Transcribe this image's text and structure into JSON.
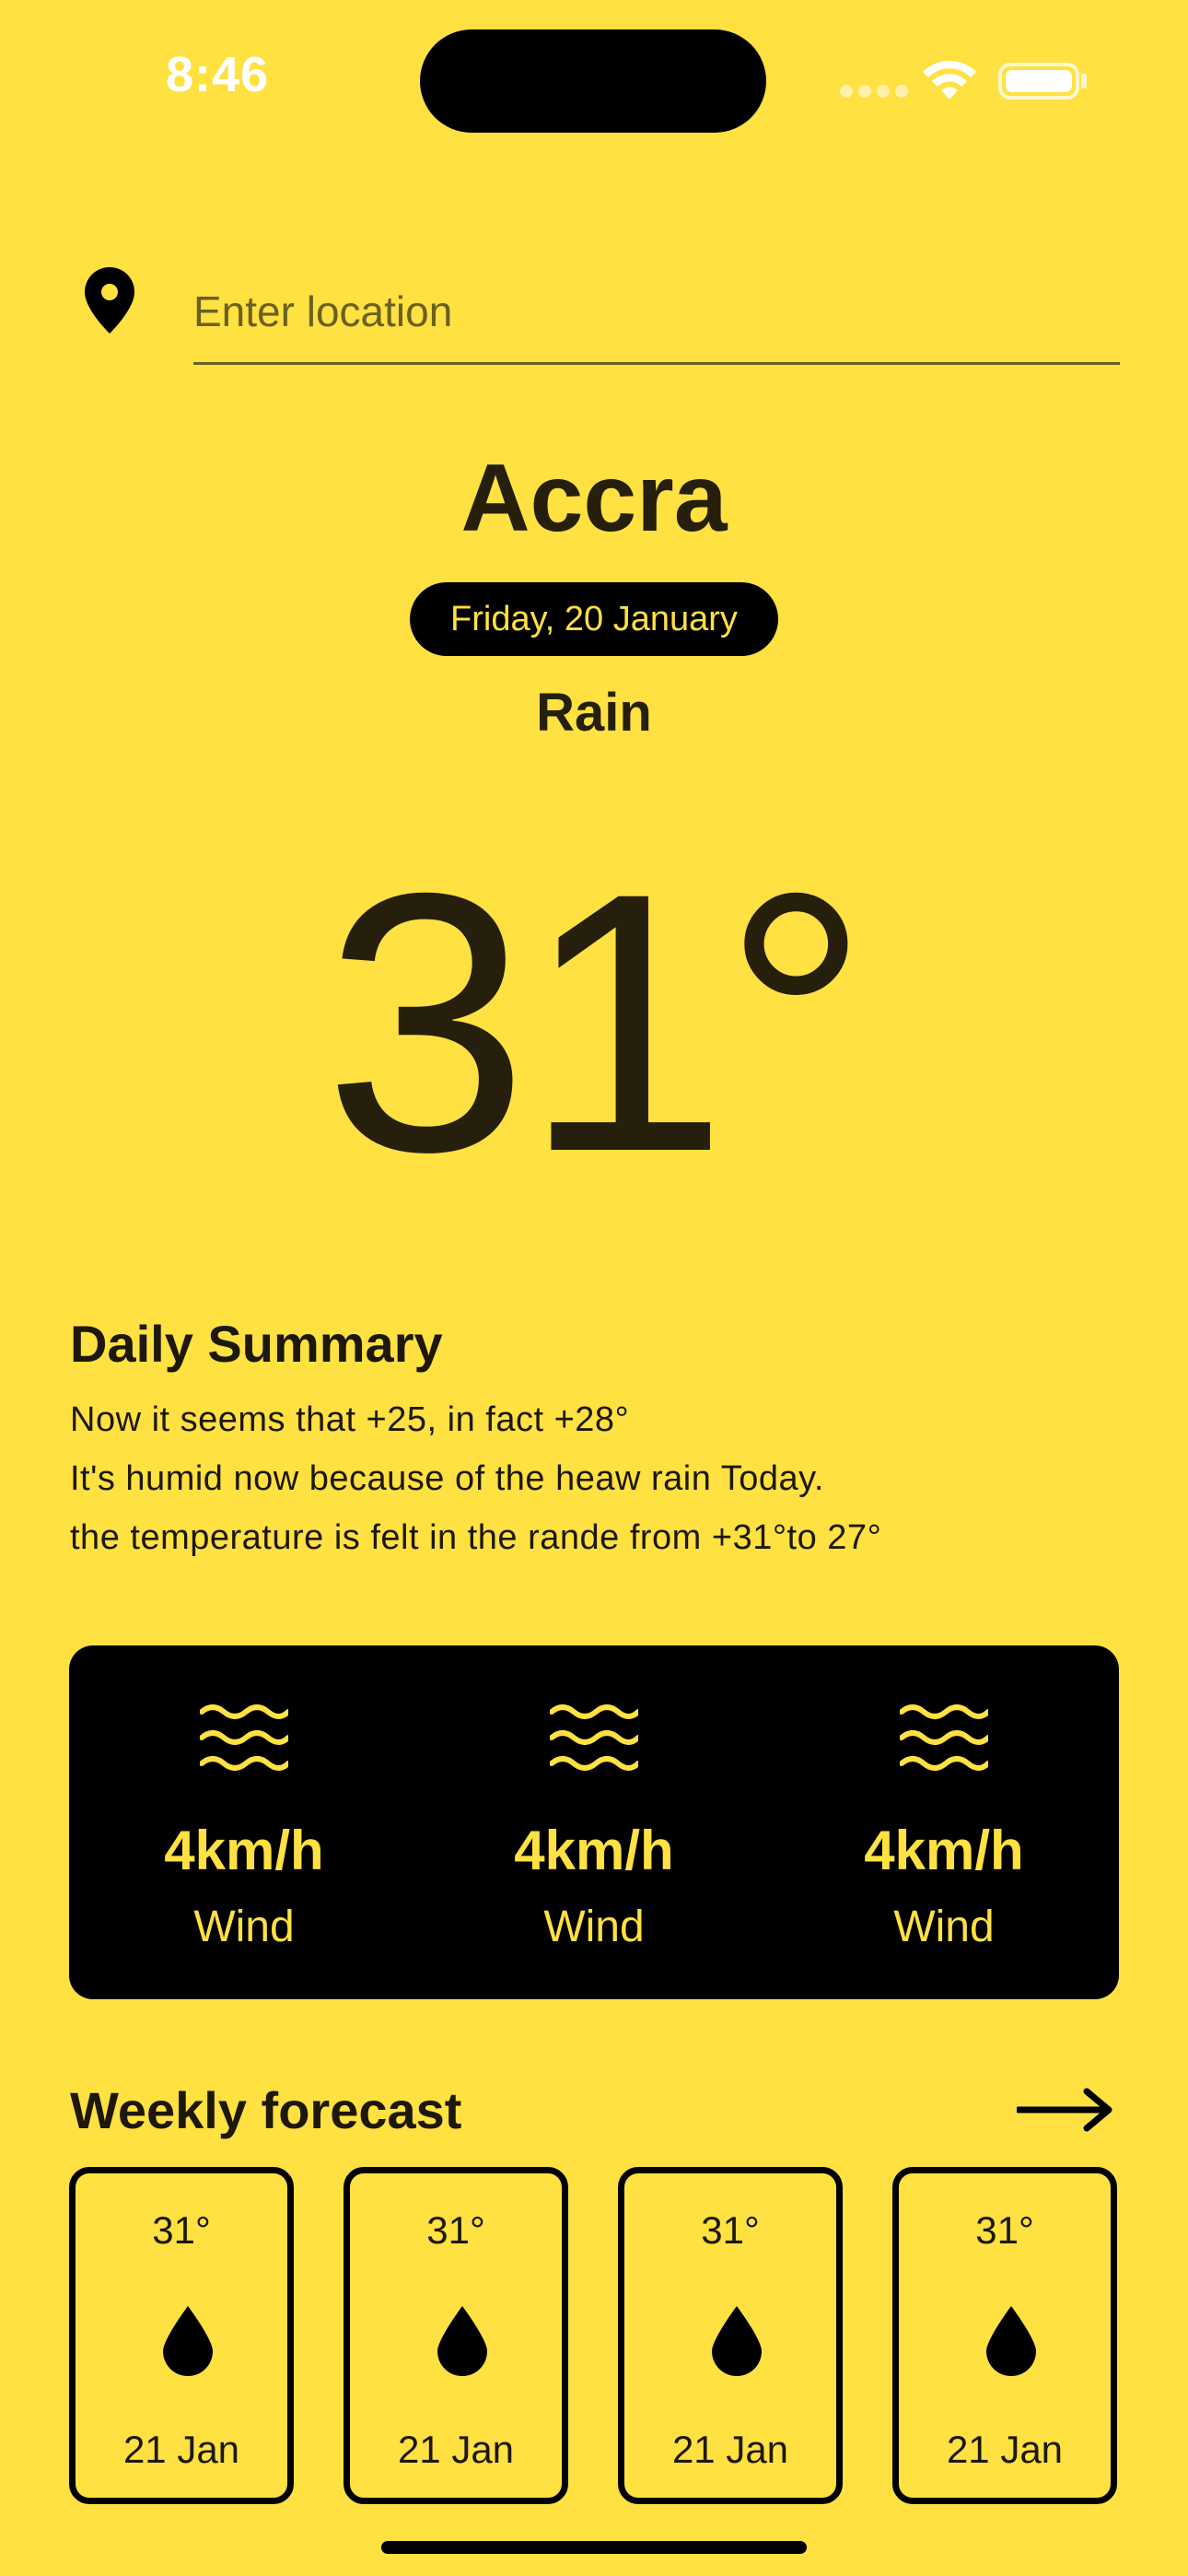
{
  "status_bar": {
    "time": "8:46"
  },
  "location": {
    "placeholder": "Enter location",
    "value": ""
  },
  "current": {
    "city": "Accra",
    "date": "Friday, 20 January",
    "condition": "Rain",
    "temperature": "31°"
  },
  "summary": {
    "title": "Daily Summary",
    "lines": [
      "Now it seems that +25, in fact +28°",
      "It's humid now because of the heaw rain Today.",
      "the temperature is felt in the rande from +31°to 27°"
    ]
  },
  "stats": [
    {
      "value": "4km/h",
      "label": "Wind",
      "icon": "wind-waves-icon"
    },
    {
      "value": "4km/h",
      "label": "Wind",
      "icon": "wind-waves-icon"
    },
    {
      "value": "4km/h",
      "label": "Wind",
      "icon": "wind-waves-icon"
    }
  ],
  "weekly": {
    "title": "Weekly forecast",
    "arrow_icon": "arrow-right-icon",
    "days": [
      {
        "temp": "31°",
        "date": "21 Jan",
        "icon": "raindrop-icon"
      },
      {
        "temp": "31°",
        "date": "21 Jan",
        "icon": "raindrop-icon"
      },
      {
        "temp": "31°",
        "date": "21 Jan",
        "icon": "raindrop-icon"
      },
      {
        "temp": "31°",
        "date": "21 Jan",
        "icon": "raindrop-icon"
      }
    ]
  },
  "colors": {
    "background": "#FFE142",
    "panel": "#000000",
    "accent": "#FFE142",
    "text": "#251F0B"
  }
}
